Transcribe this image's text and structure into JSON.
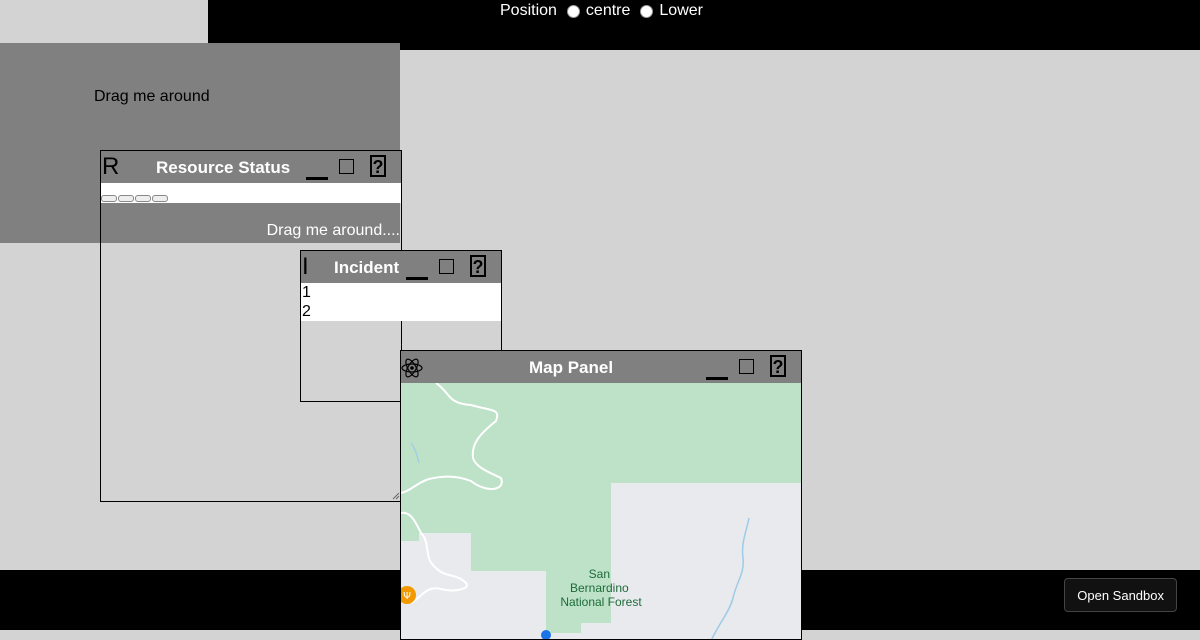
{
  "topbar": {
    "position_label": "Position",
    "options": [
      "centre",
      "Lower"
    ]
  },
  "drag_panel": {
    "label": "Drag me around",
    "label2": "Drag me around...."
  },
  "windows": {
    "resource": {
      "initial": "R",
      "title": "Resource Status"
    },
    "incident": {
      "initial": "I",
      "title": "Incident",
      "items": [
        "1",
        "2"
      ]
    },
    "map": {
      "title": "Map Panel",
      "map_label": "San\nBernardino\nNational Forest"
    }
  },
  "controls": {
    "help": "?"
  },
  "footer": {
    "sandbox_label": "Open Sandbox"
  },
  "colors": {
    "titlebar": "#808080",
    "forest": "#bde2c8",
    "land": "#e8eaed",
    "river": "#9ecbe8"
  }
}
